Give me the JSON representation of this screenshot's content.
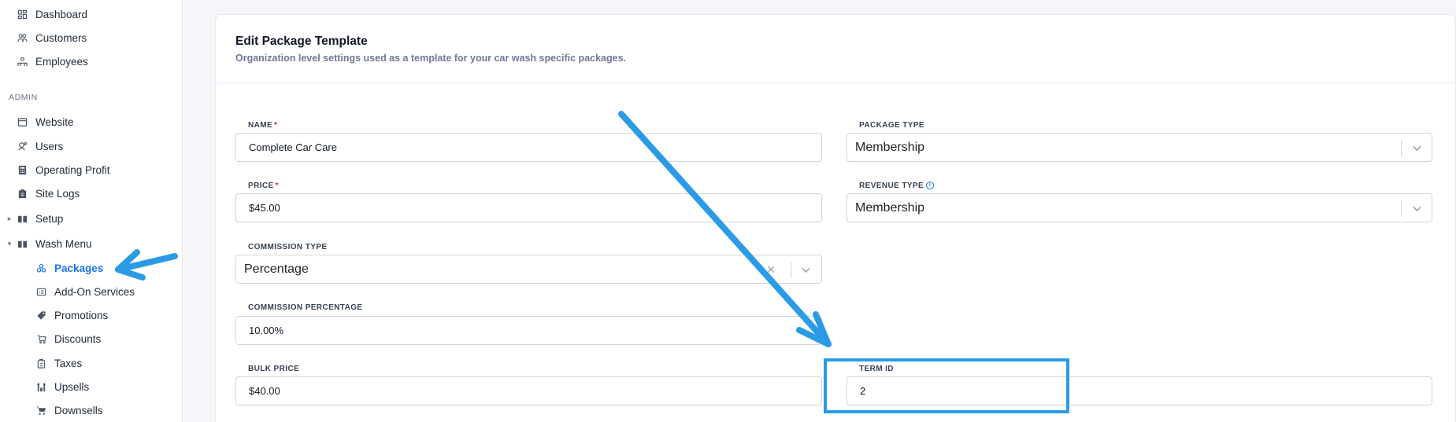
{
  "sidebar": {
    "items_top": [
      {
        "label": "Dashboard",
        "icon": "dashboard-icon"
      },
      {
        "label": "Customers",
        "icon": "customers-icon"
      },
      {
        "label": "Employees",
        "icon": "employees-icon"
      }
    ],
    "admin_label": "ADMIN",
    "admin_items": [
      {
        "label": "Website",
        "icon": "website-icon"
      },
      {
        "label": "Users",
        "icon": "users-icon"
      },
      {
        "label": "Operating Profit",
        "icon": "calculator-icon"
      },
      {
        "label": "Site Logs",
        "icon": "clipboard-icon"
      },
      {
        "label": "Setup",
        "icon": "book-icon"
      },
      {
        "label": "Wash Menu",
        "icon": "book-icon"
      }
    ],
    "wash_menu_items": [
      {
        "label": "Packages",
        "icon": "packages-icon",
        "active": true
      },
      {
        "label": "Add-On Services",
        "icon": "list-icon"
      },
      {
        "label": "Promotions",
        "icon": "tag-icon"
      },
      {
        "label": "Discounts",
        "icon": "discount-icon"
      },
      {
        "label": "Taxes",
        "icon": "taxes-icon"
      },
      {
        "label": "Upsells",
        "icon": "upsells-icon"
      },
      {
        "label": "Downsells",
        "icon": "cart-icon"
      }
    ]
  },
  "form": {
    "title": "Edit Package Template",
    "subtitle": "Organization level settings used as a template for your car wash specific packages.",
    "name_label": "NAME",
    "name_value": "Complete Car Care",
    "package_type_label": "PACKAGE TYPE",
    "package_type_value": "Membership",
    "price_label": "PRICE",
    "price_value": "$45.00",
    "revenue_type_label": "REVENUE TYPE",
    "revenue_type_value": "Membership",
    "commission_type_label": "COMMISSION TYPE",
    "commission_type_value": "Percentage",
    "commission_percentage_label": "COMMISSION PERCENTAGE",
    "commission_percentage_value": "10.00%",
    "bulk_price_label": "BULK PRICE",
    "bulk_price_value": "$40.00",
    "term_id_label": "TERM ID",
    "term_id_value": "2"
  },
  "colors": {
    "accent": "#1a73e8",
    "annotation": "#2b9be6",
    "required": "#e02424"
  }
}
